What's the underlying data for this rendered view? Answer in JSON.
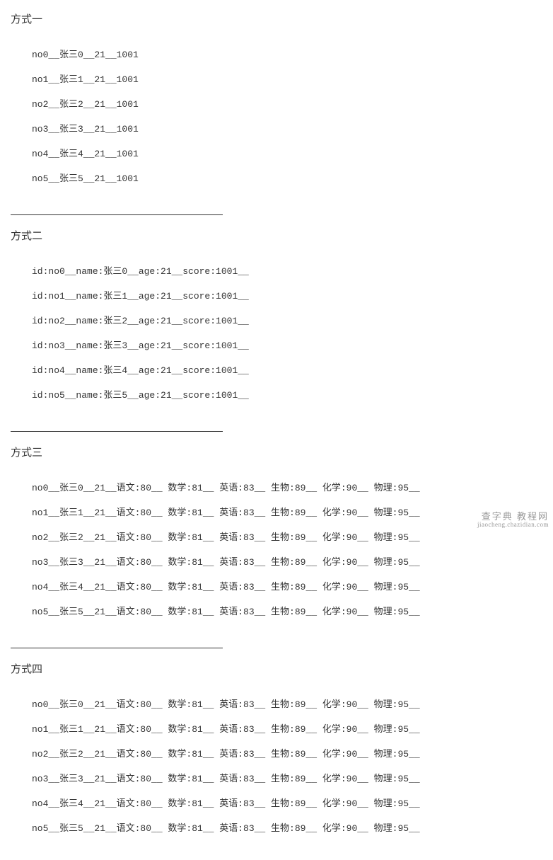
{
  "sections": {
    "s1": {
      "title": "方式一"
    },
    "s2": {
      "title": "方式二"
    },
    "s3": {
      "title": "方式三"
    },
    "s4": {
      "title": "方式四"
    }
  },
  "block1": {
    "l0": "no0__张三0__21__1001",
    "l1": "no1__张三1__21__1001",
    "l2": "no2__张三2__21__1001",
    "l3": "no3__张三3__21__1001",
    "l4": "no4__张三4__21__1001",
    "l5": "no5__张三5__21__1001"
  },
  "block2": {
    "l0": "id:no0__name:张三0__age:21__score:1001__",
    "l1": "id:no1__name:张三1__age:21__score:1001__",
    "l2": "id:no2__name:张三2__age:21__score:1001__",
    "l3": "id:no3__name:张三3__age:21__score:1001__",
    "l4": "id:no4__name:张三4__age:21__score:1001__",
    "l5": "id:no5__name:张三5__age:21__score:1001__"
  },
  "block3": {
    "l0": "no0__张三0__21__语文:80__ 数学:81__ 英语:83__ 生物:89__ 化学:90__ 物理:95__",
    "l1": "no1__张三1__21__语文:80__ 数学:81__ 英语:83__ 生物:89__ 化学:90__ 物理:95__",
    "l2": "no2__张三2__21__语文:80__ 数学:81__ 英语:83__ 生物:89__ 化学:90__ 物理:95__",
    "l3": "no3__张三3__21__语文:80__ 数学:81__ 英语:83__ 生物:89__ 化学:90__ 物理:95__",
    "l4": "no4__张三4__21__语文:80__ 数学:81__ 英语:83__ 生物:89__ 化学:90__ 物理:95__",
    "l5": "no5__张三5__21__语文:80__ 数学:81__ 英语:83__ 生物:89__ 化学:90__ 物理:95__"
  },
  "block4": {
    "l0": "no0__张三0__21__语文:80__ 数学:81__ 英语:83__ 生物:89__ 化学:90__ 物理:95__",
    "l1": "no1__张三1__21__语文:80__ 数学:81__ 英语:83__ 生物:89__ 化学:90__ 物理:95__",
    "l2": "no2__张三2__21__语文:80__ 数学:81__ 英语:83__ 生物:89__ 化学:90__ 物理:95__",
    "l3": "no3__张三3__21__语文:80__ 数学:81__ 英语:83__ 生物:89__ 化学:90__ 物理:95__",
    "l4": "no4__张三4__21__语文:80__ 数学:81__ 英语:83__ 生物:89__ 化学:90__ 物理:95__",
    "l5": "no5__张三5__21__语文:80__ 数学:81__ 英语:83__ 生物:89__ 化学:90__ 物理:95__"
  },
  "watermark": {
    "top": "查字典  教程网",
    "bottom": "jiaocheng.chazidian.com"
  }
}
